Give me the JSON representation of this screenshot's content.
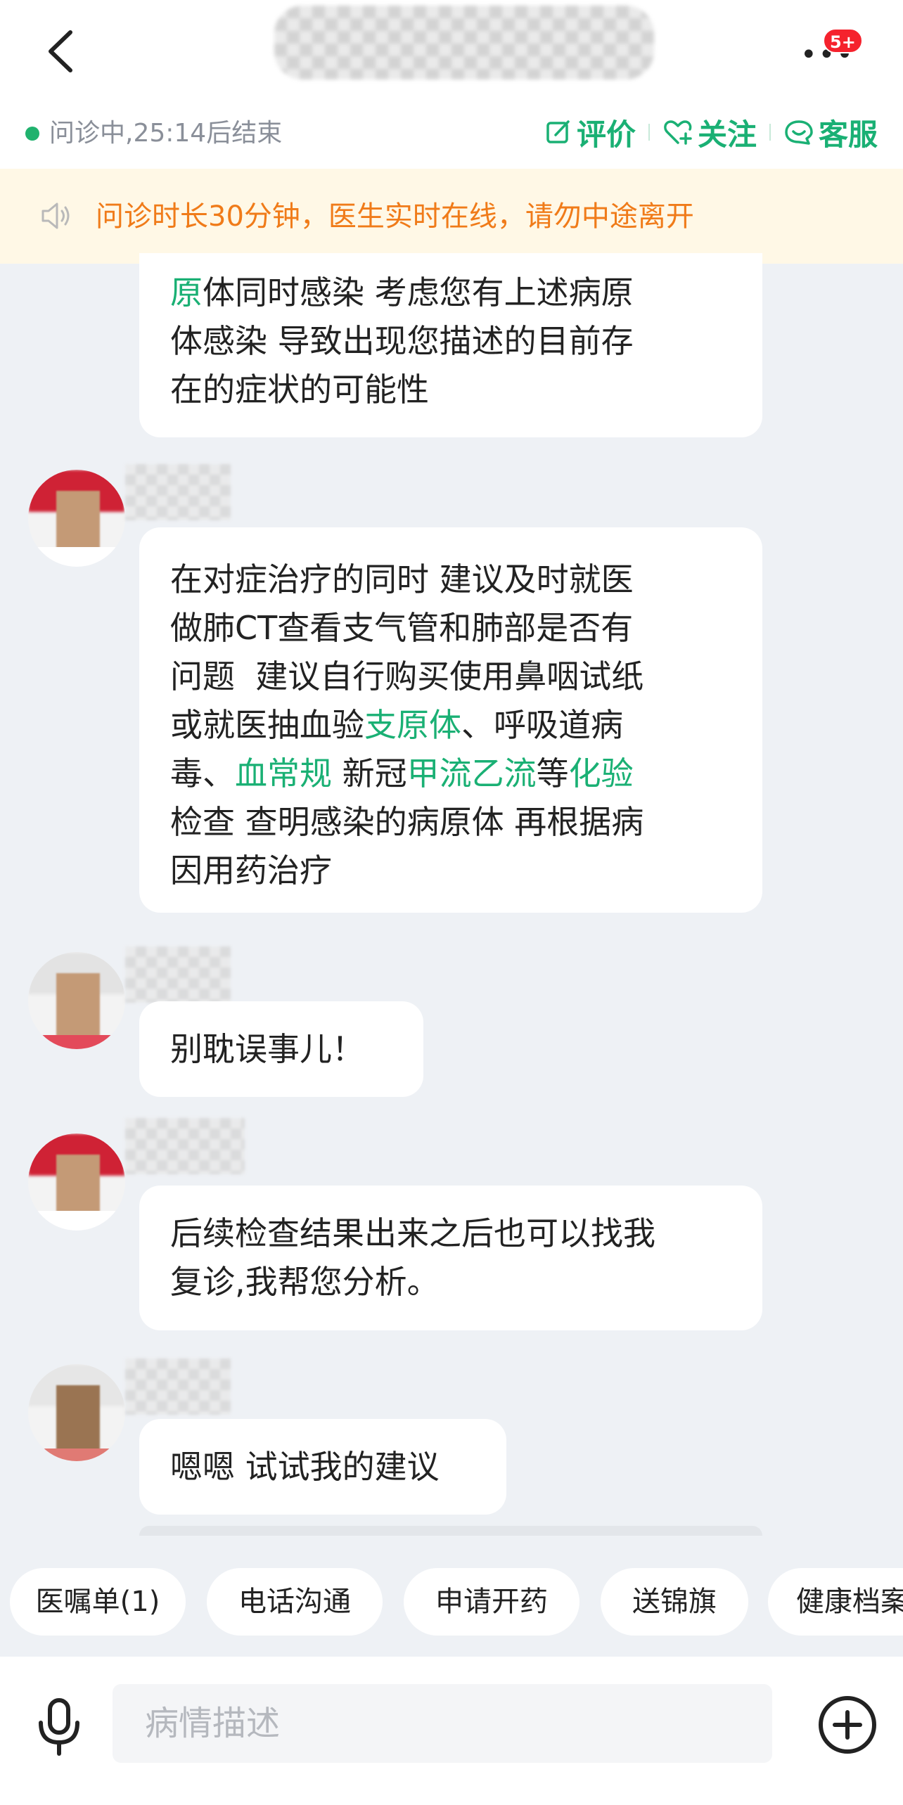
{
  "header": {
    "badge": "5+",
    "status": "问诊中,25:14后结束",
    "actions": {
      "rate": "评价",
      "follow": "关注",
      "service": "客服"
    }
  },
  "notice": {
    "text": "问诊时长30分钟，医生实时在线，请勿中途离开"
  },
  "messages": {
    "m1": {
      "lines": [
        [
          {
            "t": "原",
            "hl": true
          },
          {
            "t": "体同时感染 考虑您有上述病原"
          }
        ],
        [
          {
            "t": "体感染 导致出现您描述的目前存"
          }
        ],
        [
          {
            "t": "在的症状的可能性"
          }
        ]
      ]
    },
    "m2": {
      "lines": [
        [
          {
            "t": "在对症治疗的同时 建议及时就医"
          }
        ],
        [
          {
            "t": "做肺CT查看支气管和肺部是否有"
          }
        ],
        [
          {
            "t": "问题  建议自行购买使用鼻咽试纸"
          }
        ],
        [
          {
            "t": "或就医抽血验"
          },
          {
            "t": "支原体",
            "hl": true
          },
          {
            "t": "、呼吸道病"
          }
        ],
        [
          {
            "t": "毒、"
          },
          {
            "t": "血常规",
            "hl": true
          },
          {
            "t": " 新冠"
          },
          {
            "t": "甲流乙流",
            "hl": true
          },
          {
            "t": "等"
          },
          {
            "t": "化验",
            "hl": true
          }
        ],
        [
          {
            "t": "检查 查明感染的病原体 再根据病"
          }
        ],
        [
          {
            "t": "因用药治疗"
          }
        ]
      ]
    },
    "m3": {
      "lines": [
        [
          {
            "t": "别耽误事儿！"
          }
        ]
      ]
    },
    "m4": {
      "lines": [
        [
          {
            "t": "后续检查结果出来之后也可以找我"
          }
        ],
        [
          {
            "t": "复诊,我帮您分析。"
          }
        ]
      ]
    },
    "m5": {
      "lines": [
        [
          {
            "t": "嗯嗯 试试我的建议"
          }
        ]
      ]
    }
  },
  "quick_actions": [
    "医嘱单(1)",
    "电话沟通",
    "申请开药",
    "送锦旗",
    "健康档案"
  ],
  "input": {
    "placeholder": "病情描述"
  },
  "colors": {
    "accent": "#1ab074",
    "notice_text": "#f07b19",
    "badge": "#f5222d"
  }
}
